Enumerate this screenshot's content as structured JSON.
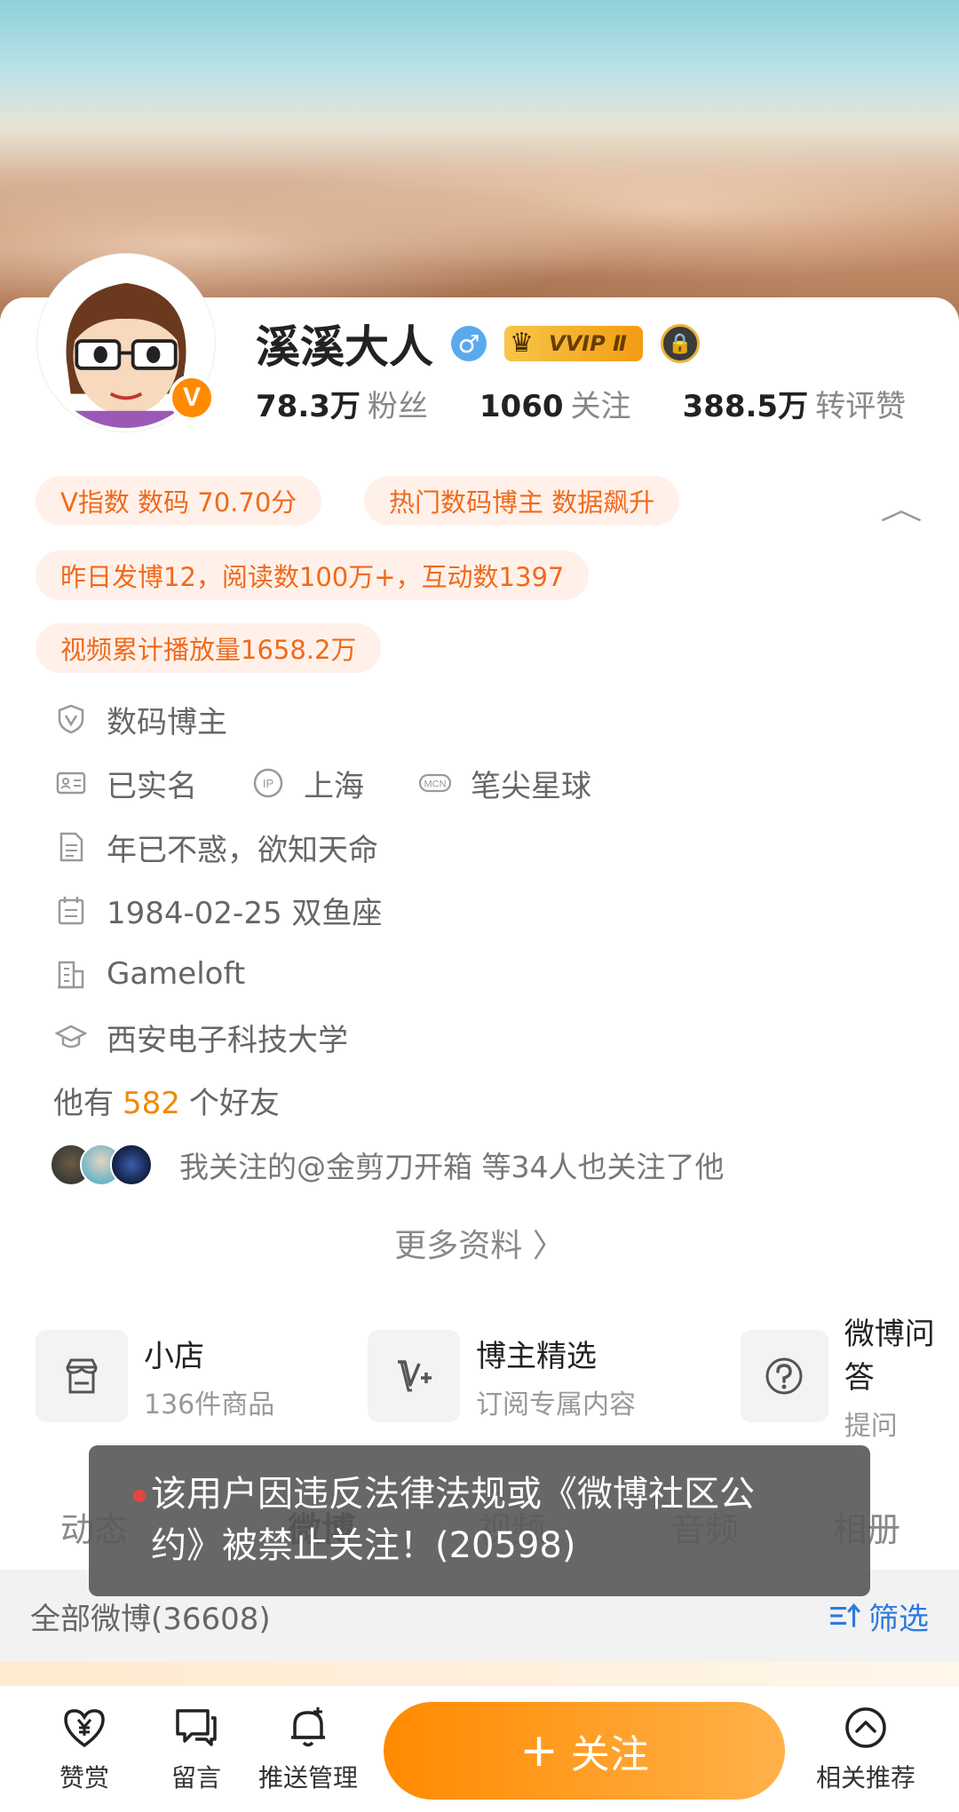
{
  "profile": {
    "name": "溪溪大人",
    "gender_symbol": "♂",
    "vip_label": "VVIP Ⅱ",
    "badge_letter": "V",
    "stats": [
      {
        "value": "78.3万",
        "label": "粉丝"
      },
      {
        "value": "1060",
        "label": "关注"
      },
      {
        "value": "388.5万",
        "label": "转评赞"
      }
    ]
  },
  "tags": [
    "V指数 数码 70.70分",
    "热门数码博主 数据飙升",
    "昨日发博12，阅读数100万+，互动数1397",
    "视频累计播放量1658.2万"
  ],
  "collapse_icon": "chevron-up-icon",
  "info": {
    "certification": "数码博主",
    "real_name": "已实名",
    "ip_label": "IP",
    "ip_location": "上海",
    "mcn_label": "MCN",
    "mcn": "笔尖星球",
    "bio": "年已不惑，欲知天命",
    "birthday": "1984-02-25 双鱼座",
    "company": "Gameloft",
    "school": "西安电子科技大学"
  },
  "friends": {
    "prefix": "他有",
    "count": "582",
    "suffix": "个好友"
  },
  "mutual_follow": "我关注的@金剪刀开箱 等34人也关注了他",
  "more_info": "更多资料 〉",
  "features": [
    {
      "title": "小店",
      "subtitle": "136件商品",
      "icon": "store-icon"
    },
    {
      "title": "博主精选",
      "subtitle": "订阅专属内容",
      "icon": "v-plus-icon"
    },
    {
      "title": "微博问答",
      "subtitle": "提问",
      "icon": "question-icon"
    }
  ],
  "tabs": [
    "动态",
    "微博",
    "视频",
    "音频",
    "相册"
  ],
  "filter_bar": {
    "all_posts": "全部微博(36608)",
    "filter": "筛选"
  },
  "toast": {
    "line1": "该用户因违反法律法规或《微博社区公",
    "line2": "约》被禁止关注！(20598)"
  },
  "bottom_bar": {
    "reward": "赞赏",
    "message": "留言",
    "push": "推送管理",
    "follow": "关注",
    "follow_plus": "+",
    "related": "相关推荐"
  },
  "colors": {
    "accent_orange": "#ff8a00",
    "tag_bg": "#fff1ea",
    "tag_text": "#f06a1c",
    "link_blue": "#2c7be0"
  }
}
